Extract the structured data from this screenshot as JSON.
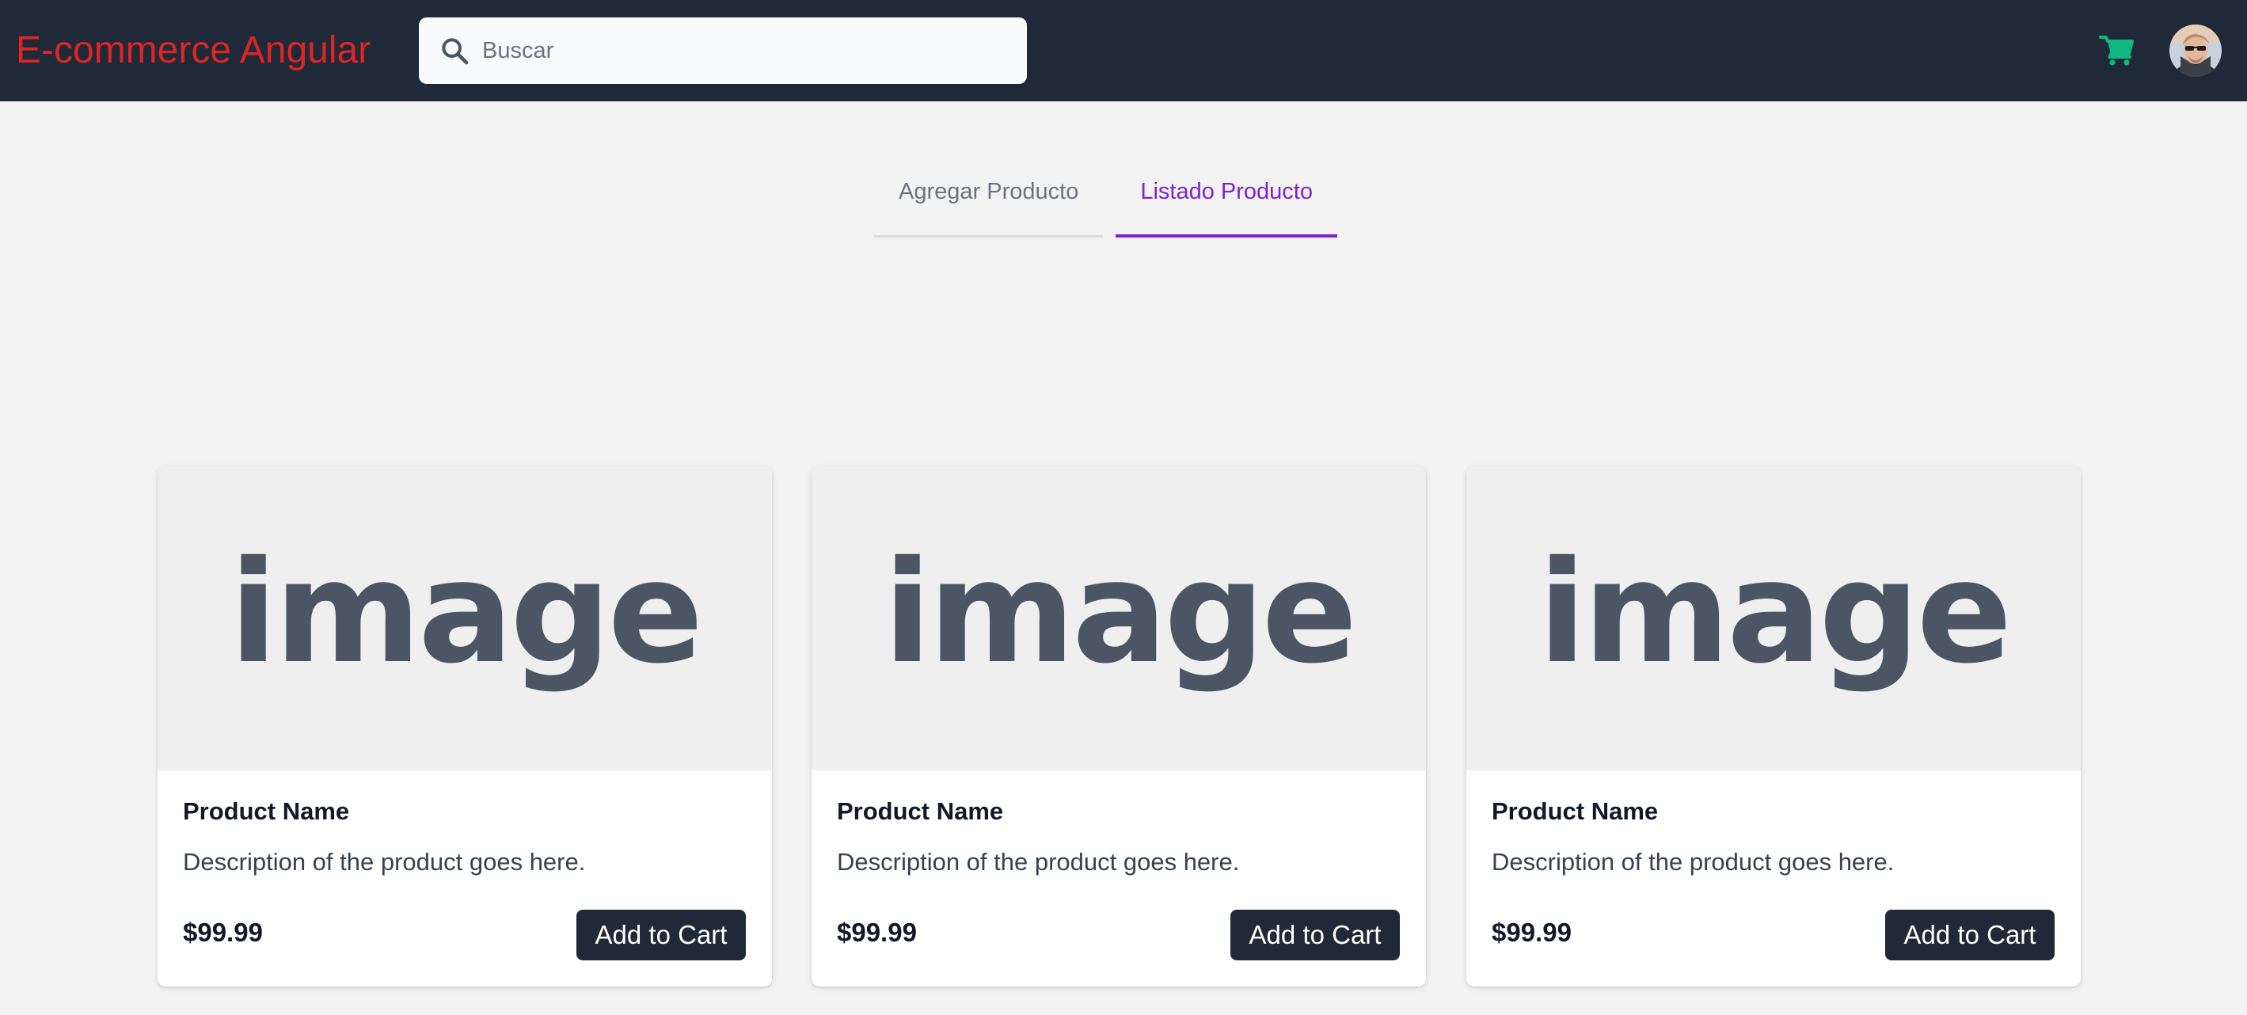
{
  "header": {
    "brand": "E-commerce Angular",
    "search_placeholder": "Buscar",
    "search_icon": "search-icon",
    "cart_icon": "shopping-cart-icon",
    "cart_color": "#10b981",
    "avatar_icon": "user-avatar"
  },
  "tabs": [
    {
      "label": "Agregar Producto",
      "active": false
    },
    {
      "label": "Listado Producto",
      "active": true
    }
  ],
  "colors": {
    "header_bg": "#1f2937",
    "brand": "#dc2626",
    "tab_active": "#7e22ce",
    "button_bg": "#1f2937"
  },
  "products": [
    {
      "image_text": "image",
      "name": "Product Name",
      "description": "Description of the product goes here.",
      "price": "$99.99",
      "button": "Add to Cart"
    },
    {
      "image_text": "image",
      "name": "Product Name",
      "description": "Description of the product goes here.",
      "price": "$99.99",
      "button": "Add to Cart"
    },
    {
      "image_text": "image",
      "name": "Product Name",
      "description": "Description of the product goes here.",
      "price": "$99.99",
      "button": "Add to Cart"
    }
  ]
}
